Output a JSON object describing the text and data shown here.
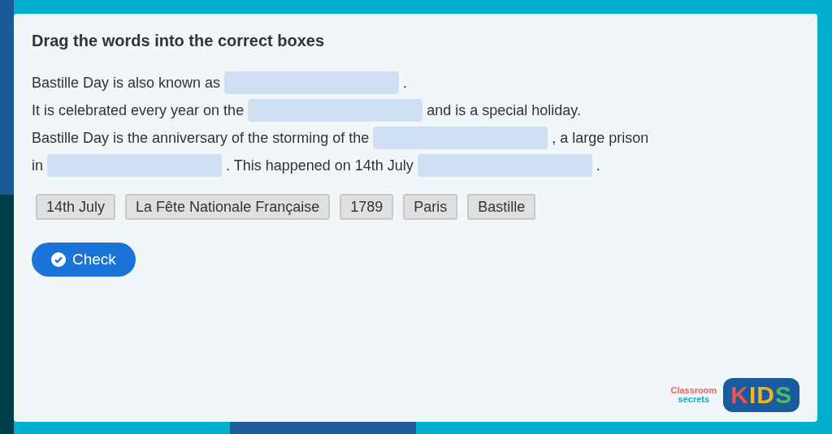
{
  "title": "Drag the words into the correct boxes",
  "lines": [
    [
      {
        "kind": "text",
        "text": "Bastille Day is also known as"
      },
      {
        "kind": "blank"
      },
      {
        "kind": "text",
        "text": "."
      }
    ],
    [
      {
        "kind": "text",
        "text": "It is celebrated every year on the"
      },
      {
        "kind": "blank"
      },
      {
        "kind": "text",
        "text": "and is a special holiday."
      }
    ],
    [
      {
        "kind": "text",
        "text": "Bastille Day is the anniversary of the storming of the"
      },
      {
        "kind": "blank"
      },
      {
        "kind": "text",
        "text": ", a large prison"
      }
    ],
    [
      {
        "kind": "text",
        "text": "in"
      },
      {
        "kind": "blank"
      },
      {
        "kind": "text",
        "text": ". This happened on 14th July"
      },
      {
        "kind": "blank"
      },
      {
        "kind": "text",
        "text": "."
      }
    ]
  ],
  "words": [
    "14th July",
    "La Fête Nationale Française",
    "1789",
    "Paris",
    "Bastille"
  ],
  "check_button": "Check",
  "logo": {
    "line_1": "Classroom",
    "line_2": "secrets",
    "badge": "KIDS"
  }
}
